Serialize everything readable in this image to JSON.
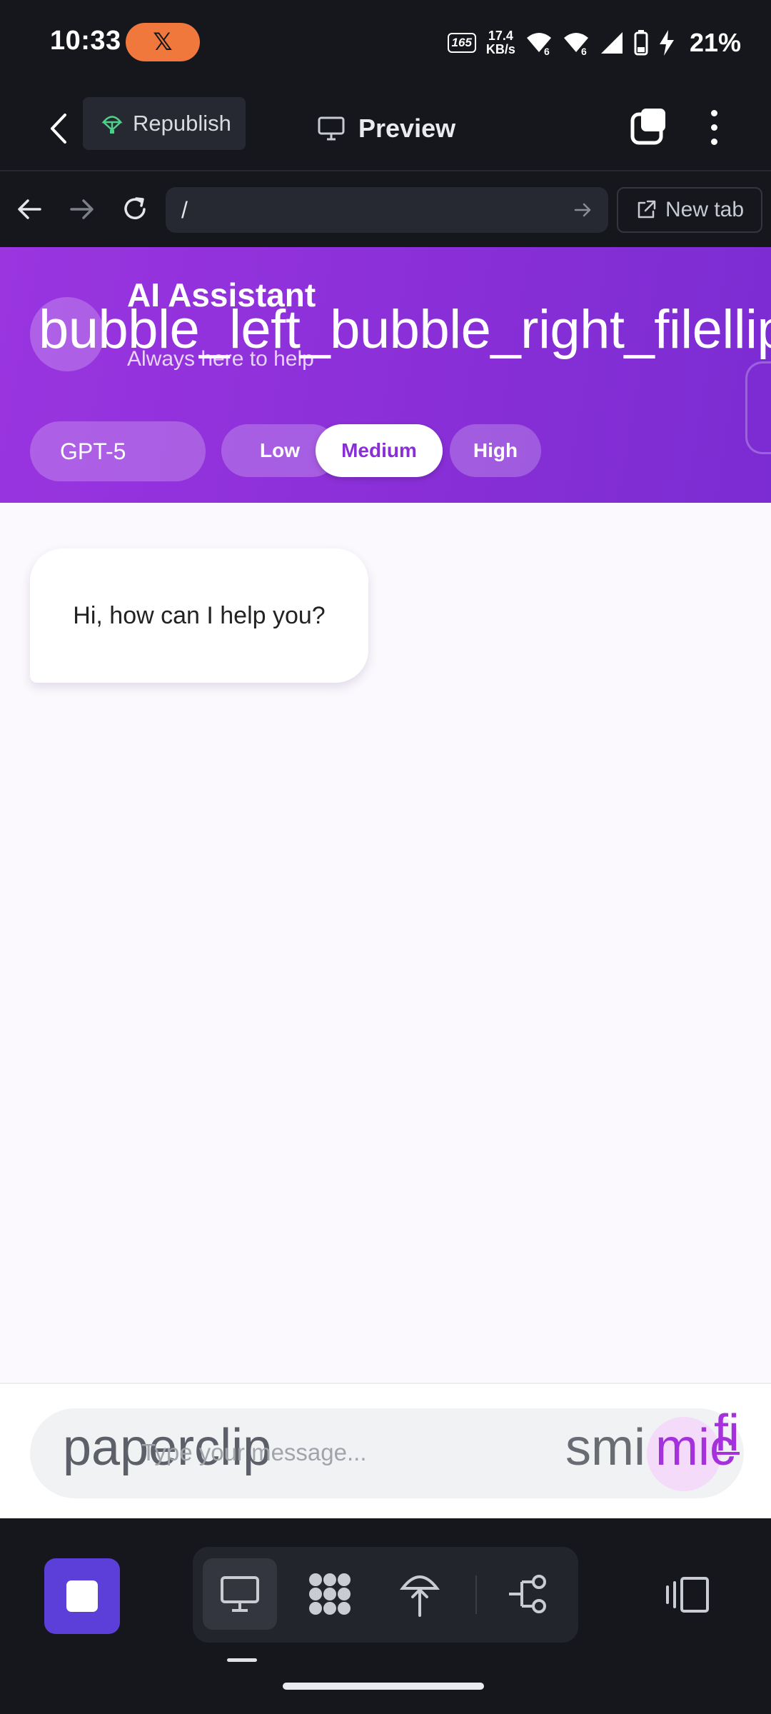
{
  "status_bar": {
    "time": "10:33",
    "badge_label": "𝕏",
    "refresh_rate": "165",
    "net_speed_value": "17.4",
    "net_speed_unit": "KB/s",
    "battery": "21%"
  },
  "app_header": {
    "republish_label": "Republish",
    "preview_label": "Preview"
  },
  "browser": {
    "url": "/",
    "new_tab_label": "New tab"
  },
  "chat": {
    "title": "AI Assistant",
    "subtitle": "Always here to help",
    "header_icon_text": "bubble_left_bubble_right_filellip",
    "model": "GPT-5",
    "effort_options": [
      "Low",
      "Medium",
      "High"
    ],
    "effort_selected": "Medium",
    "messages": [
      {
        "role": "assistant",
        "text": "Hi, how can I help you?"
      }
    ],
    "composer": {
      "placeholder": "Type your message...",
      "attach_icon_text": "paperclip",
      "emoji_icon_text": "smi",
      "mic_icon_text": "mic",
      "send_icon_text": "fi"
    }
  },
  "colors": {
    "header_gradient_start": "#9a35e0",
    "header_gradient_end": "#7b2cd2",
    "accent": "#8a2fd8",
    "stop_button": "#5b3fd8",
    "badge": "#f0783c"
  }
}
